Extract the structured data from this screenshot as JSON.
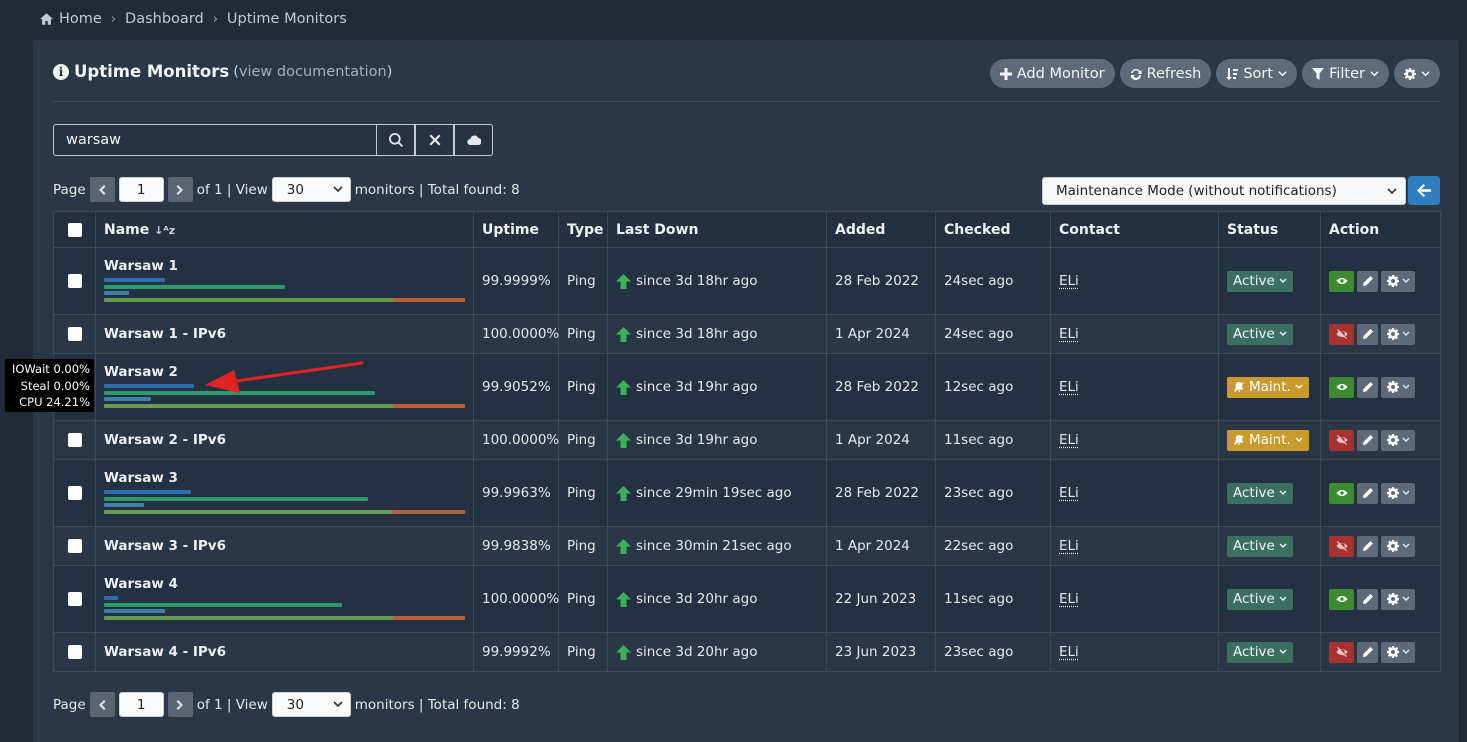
{
  "breadcrumb": [
    "Home",
    "Dashboard",
    "Uptime Monitors"
  ],
  "panel": {
    "title": "Uptime Monitors",
    "doc_open": "(",
    "doc_link": "view documentation",
    "doc_close": ")"
  },
  "toolbar": {
    "add": "Add Monitor",
    "refresh": "Refresh",
    "sort": "Sort",
    "filter": "Filter"
  },
  "search": {
    "value": "warsaw"
  },
  "pagination": {
    "page_label": "Page",
    "page": "1",
    "of": "of 1 | View",
    "per_page": "30",
    "summary": "monitors | Total found: 8"
  },
  "bulk_action": {
    "selected": "Maintenance Mode (without notifications)"
  },
  "table": {
    "headers": [
      "Name",
      "Uptime",
      "Type",
      "Last Down",
      "Added",
      "Checked",
      "Contact",
      "Status",
      "Action"
    ],
    "rows": [
      {
        "name": "Warsaw 1",
        "uptime": "99.9999%",
        "type": "Ping",
        "last_down": "since 3d 18hr ago",
        "added": "28 Feb 2022",
        "checked": "24sec ago",
        "contact": "ELi",
        "status": "Active",
        "monitoring": "on",
        "bars": [
          0.17,
          0.5,
          0.07
        ]
      },
      {
        "name": "Warsaw 1 - IPv6",
        "uptime": "100.0000%",
        "type": "Ping",
        "last_down": "since 3d 18hr ago",
        "added": "1 Apr 2024",
        "checked": "24sec ago",
        "contact": "ELi",
        "status": "Active",
        "monitoring": "off",
        "bars": []
      },
      {
        "name": "Warsaw 2",
        "uptime": "99.9052%",
        "type": "Ping",
        "last_down": "since 3d 19hr ago",
        "added": "28 Feb 2022",
        "checked": "12sec ago",
        "contact": "ELi",
        "status": "Maint.",
        "monitoring": "on",
        "bars": [
          0.25,
          0.75,
          0.13
        ]
      },
      {
        "name": "Warsaw 2 - IPv6",
        "uptime": "100.0000%",
        "type": "Ping",
        "last_down": "since 3d 19hr ago",
        "added": "1 Apr 2024",
        "checked": "11sec ago",
        "contact": "ELi",
        "status": "Maint.",
        "monitoring": "off",
        "bars": []
      },
      {
        "name": "Warsaw 3",
        "uptime": "99.9963%",
        "type": "Ping",
        "last_down": "since 29min 19sec ago",
        "added": "28 Feb 2022",
        "checked": "23sec ago",
        "contact": "ELi",
        "status": "Active",
        "monitoring": "on",
        "bars": [
          0.24,
          0.73,
          0.11
        ]
      },
      {
        "name": "Warsaw 3 - IPv6",
        "uptime": "99.9838%",
        "type": "Ping",
        "last_down": "since 30min 21sec ago",
        "added": "1 Apr 2024",
        "checked": "22sec ago",
        "contact": "ELi",
        "status": "Active",
        "monitoring": "off",
        "bars": []
      },
      {
        "name": "Warsaw 4",
        "uptime": "100.0000%",
        "type": "Ping",
        "last_down": "since 3d 20hr ago",
        "added": "22 Jun 2023",
        "checked": "11sec ago",
        "contact": "ELi",
        "status": "Active",
        "monitoring": "on",
        "bars": [
          0.04,
          0.66,
          0.17
        ]
      },
      {
        "name": "Warsaw 4 - IPv6",
        "uptime": "99.9992%",
        "type": "Ping",
        "last_down": "since 3d 20hr ago",
        "added": "23 Jun 2023",
        "checked": "23sec ago",
        "contact": "ELi",
        "status": "Active",
        "monitoring": "off",
        "bars": []
      }
    ]
  },
  "tooltip": {
    "lines": [
      "IOWait 0.00%",
      "Steal 0.00%",
      "CPU 24.21%"
    ]
  },
  "colors": {
    "accent": "#2f7fbf",
    "active": "#3b7060",
    "maint": "#c99a2e",
    "uptime_ok": "#3bb25a",
    "annotation": "#e02424"
  },
  "icons": [
    "home-icon",
    "info-icon",
    "plus-icon",
    "refresh-icon",
    "sort-icon",
    "filter-icon",
    "gear-icon",
    "search-icon",
    "close-icon",
    "cloud-icon",
    "arrow-left-icon",
    "arrow-up-icon",
    "eye-icon",
    "eye-slash-icon",
    "pencil-icon",
    "bell-slash-icon"
  ]
}
